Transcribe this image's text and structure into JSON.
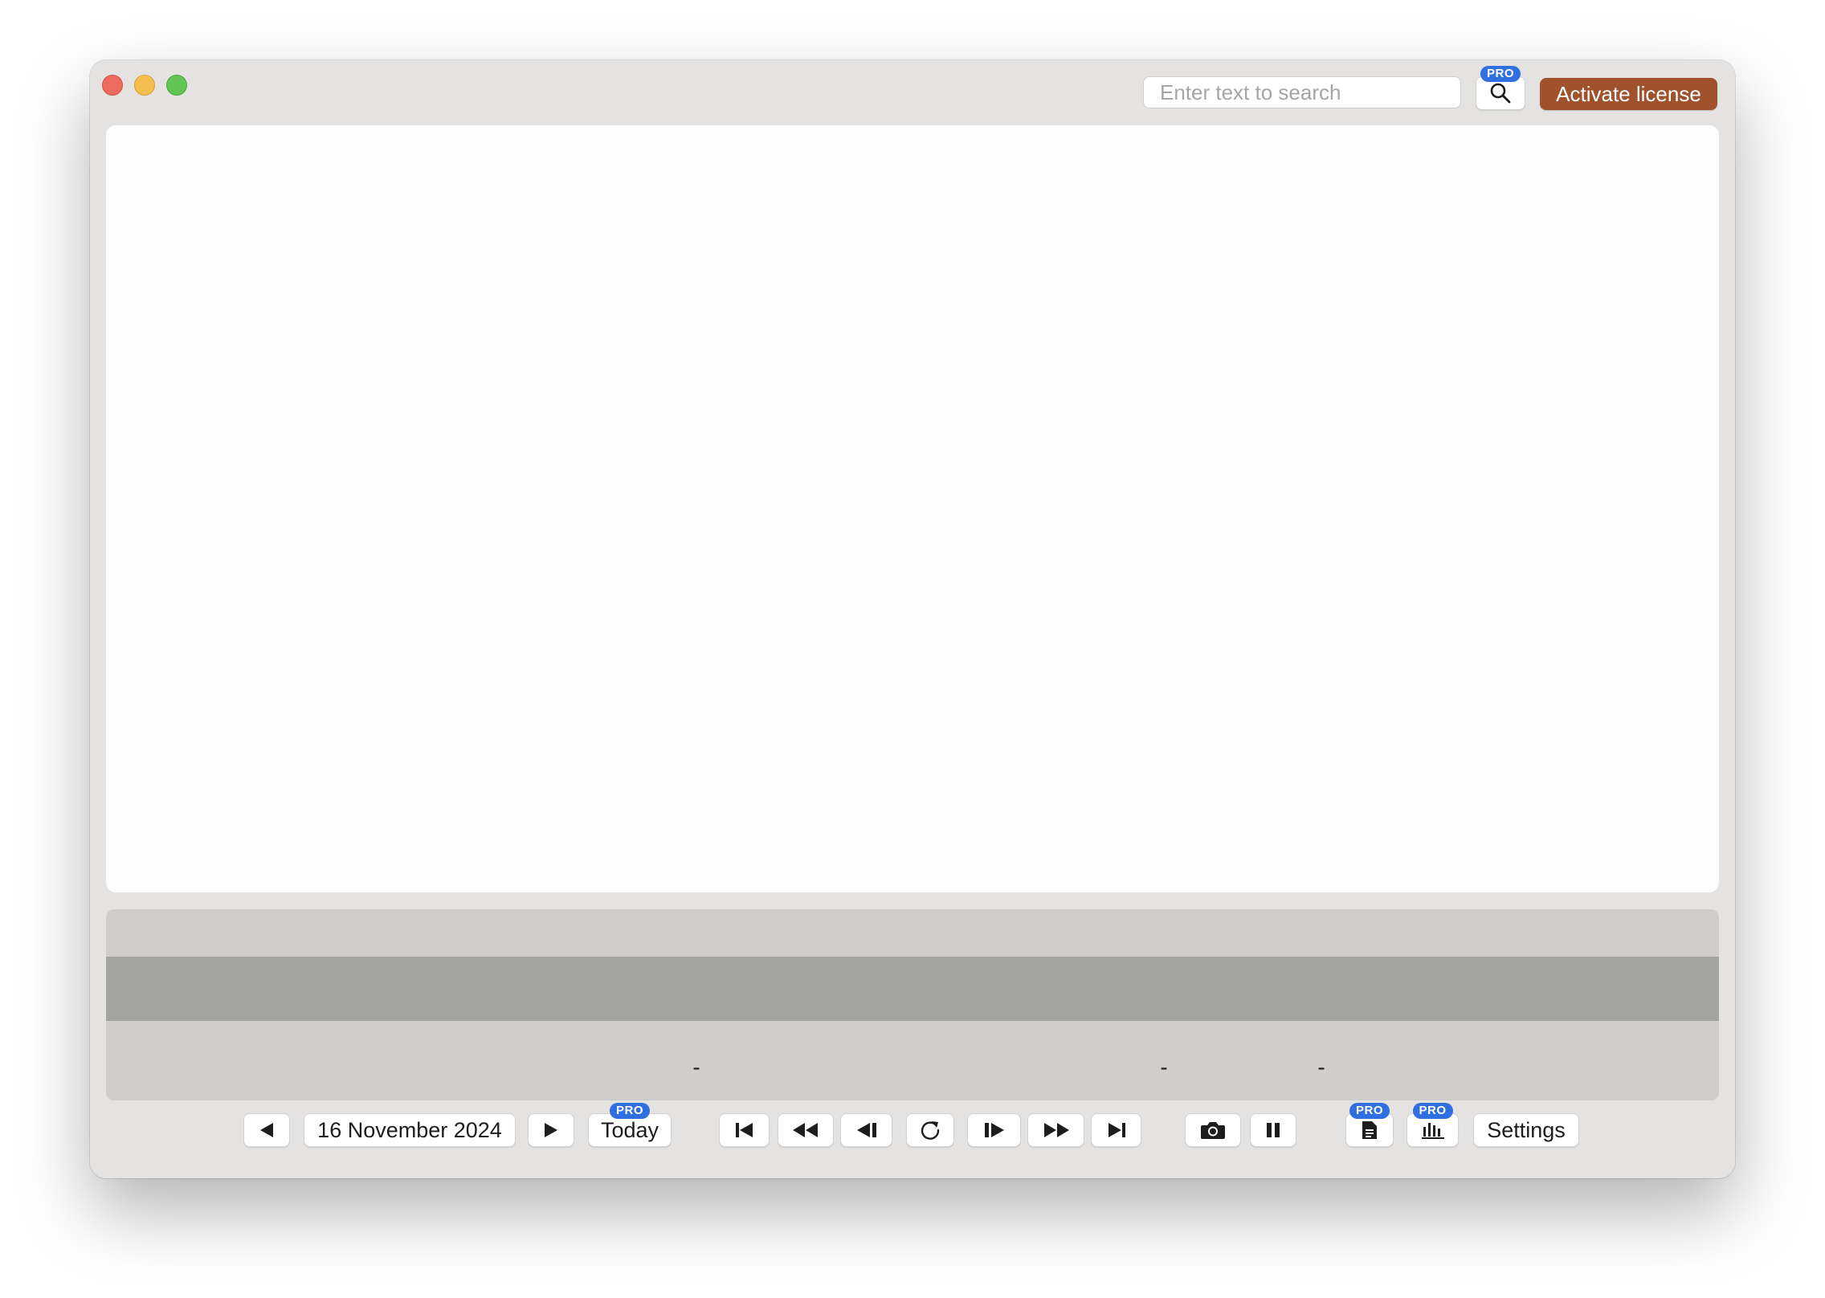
{
  "window": {
    "controls": [
      "close",
      "minimize",
      "maximize"
    ]
  },
  "header": {
    "search_placeholder": "Enter text to search",
    "search_pro_badge": "PRO",
    "activate_label": "Activate license",
    "activate_color": "#a0522d"
  },
  "toolbar": {
    "prev_day_icon": "triangle-left-icon",
    "date_label": "16 November 2024",
    "next_day_icon": "triangle-right-icon",
    "today_label": "Today",
    "today_pro_badge": "PRO",
    "separator": "-",
    "playback_icons": [
      "skip-to-start-icon",
      "rewind-icon",
      "step-back-icon",
      "reload-icon",
      "step-forward-icon",
      "fast-forward-icon",
      "skip-to-end-icon"
    ],
    "camera_icon": "camera-icon",
    "pause_icon": "pause-icon",
    "document_pro_badge": "PRO",
    "chart_pro_badge": "PRO",
    "settings_label": "Settings"
  },
  "colors": {
    "pro_badge": "#2f6fe0",
    "window_bg": "#e4e3e2",
    "timeline_bg": "#cecdcc",
    "timeline_band": "#a3a3a2"
  }
}
